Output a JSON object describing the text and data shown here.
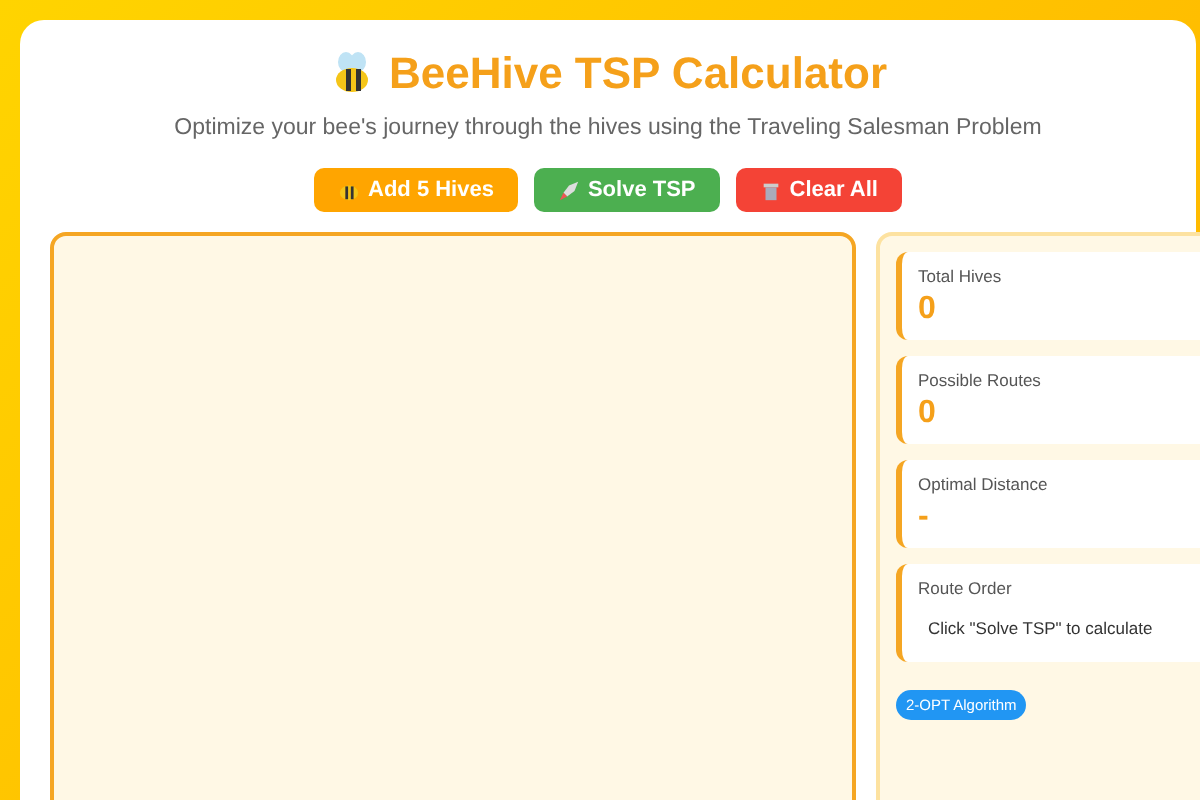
{
  "header": {
    "title": "BeeHive TSP Calculator",
    "subtitle": "Optimize your bee's journey through the hives using the Traveling Salesman Problem"
  },
  "buttons": [
    {
      "kind": "add",
      "label": "Add 5 Hives"
    },
    {
      "kind": "solve",
      "label": "Solve TSP"
    },
    {
      "kind": "clear",
      "label": "Clear All"
    }
  ],
  "stats": [
    {
      "kind": "number",
      "label": "Total Hives",
      "value": "0"
    },
    {
      "kind": "number",
      "label": "Possible Routes",
      "value": "0"
    },
    {
      "kind": "number",
      "label": "Optimal Distance",
      "value": "-"
    },
    {
      "kind": "text",
      "label": "Route Order",
      "value": "Click \"Solve TSP\" to calculate"
    }
  ],
  "badge": "2-OPT Algorithm"
}
